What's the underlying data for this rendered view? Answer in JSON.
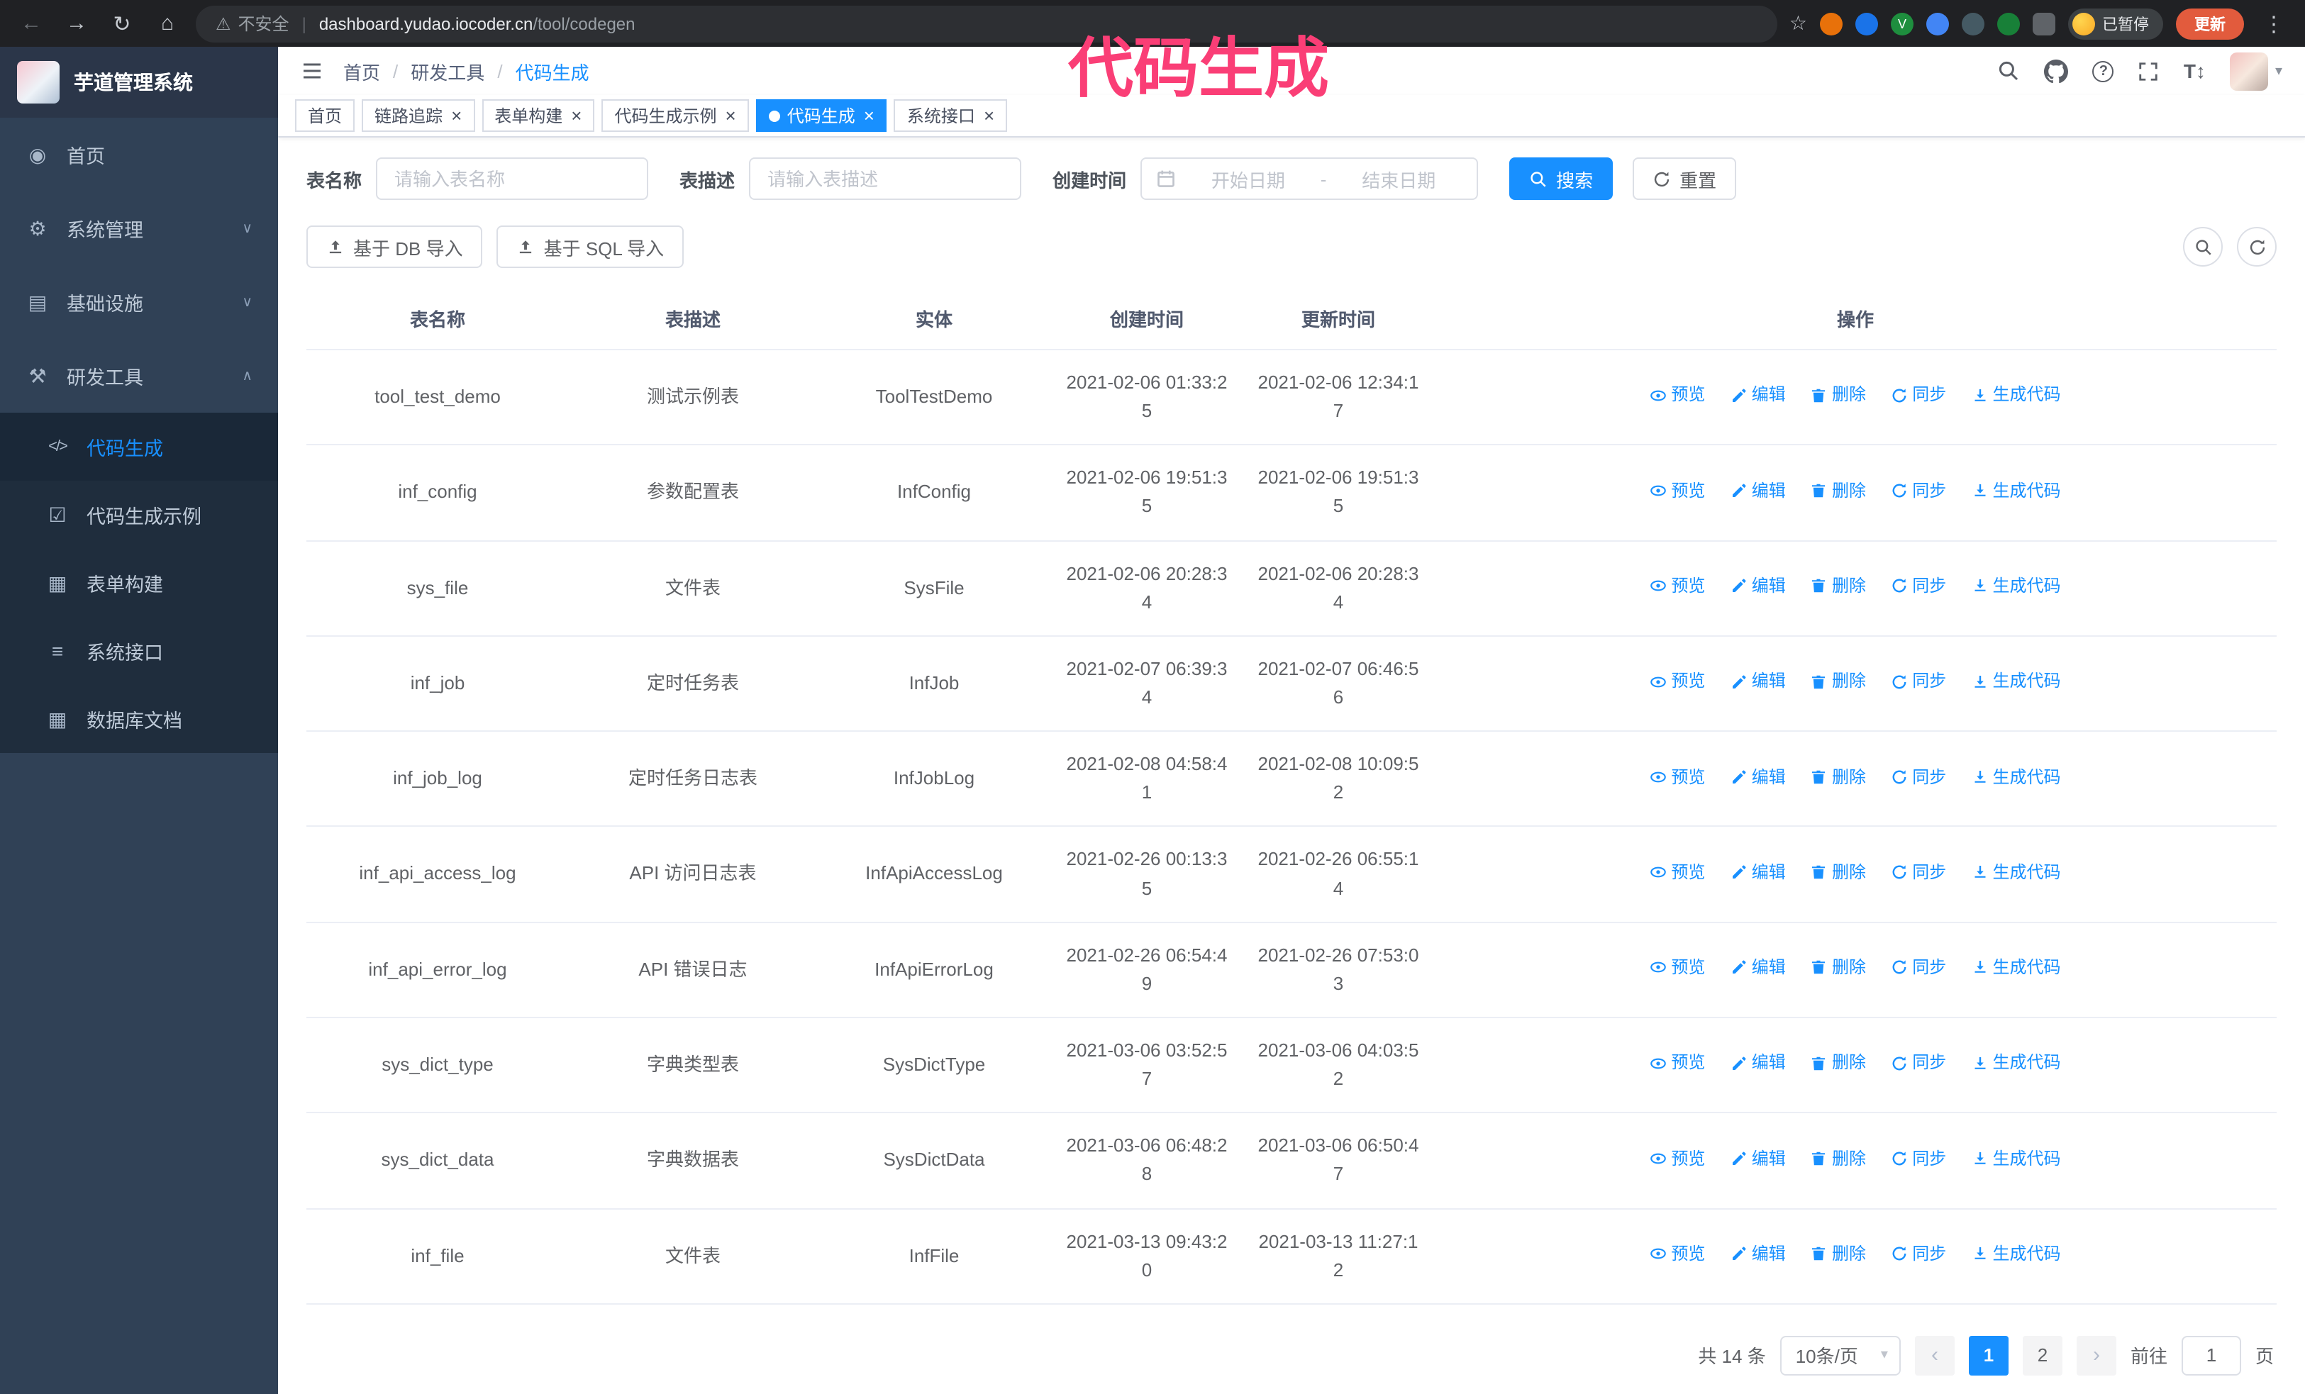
{
  "colors": {
    "accent": "#1890ff",
    "sidebar_bg": "#304156",
    "submenu_bg": "#1f2d3d",
    "annotation": "#fa3e76",
    "update_button": "#e25b3d"
  },
  "annotation": {
    "text": "代码生成"
  },
  "glyphs": {
    "back": "←",
    "forward": "→",
    "reload": "↻",
    "home": "⌂",
    "warning": "⚠",
    "star": "☆",
    "kebab": "⋮",
    "close": "×",
    "caret_down": "▾",
    "chevron_down": "∨",
    "chevron_up": "∧",
    "prev": "‹",
    "next": "›",
    "breadcrumb_sep": "/",
    "font_size": "T↕",
    "question": "?"
  },
  "browser": {
    "security_label": "不安全",
    "url_host": "dashboard.yudao.iocoder.cn",
    "url_path": "/tool/codegen",
    "paused_badge": "已暂停",
    "update_button": "更新"
  },
  "sidebar": {
    "logo_title": "芋道管理系统",
    "items": [
      {
        "label": "首页",
        "icon": "dashboard-icon",
        "glyph": "◉"
      },
      {
        "label": "系统管理",
        "icon": "gear-icon",
        "glyph": "⚙"
      },
      {
        "label": "基础设施",
        "icon": "monitor-icon",
        "glyph": "▤"
      },
      {
        "label": "研发工具",
        "icon": "tools-icon",
        "glyph": "⚒"
      }
    ],
    "subitems": [
      {
        "label": "代码生成",
        "icon": "code-icon",
        "glyph": "</>",
        "active": true
      },
      {
        "label": "代码生成示例",
        "icon": "example-icon",
        "glyph": "☑"
      },
      {
        "label": "表单构建",
        "icon": "form-builder-icon",
        "glyph": "▦"
      },
      {
        "label": "系统接口",
        "icon": "api-icon",
        "glyph": "≡"
      },
      {
        "label": "数据库文档",
        "icon": "db-doc-icon",
        "glyph": "▦"
      }
    ]
  },
  "header": {
    "breadcrumb": [
      "首页",
      "研发工具",
      "代码生成"
    ]
  },
  "tabs": [
    {
      "label": "首页",
      "closable": false,
      "active": false
    },
    {
      "label": "链路追踪",
      "closable": true,
      "active": false
    },
    {
      "label": "表单构建",
      "closable": true,
      "active": false
    },
    {
      "label": "代码生成示例",
      "closable": true,
      "active": false
    },
    {
      "label": "代码生成",
      "closable": true,
      "active": true
    },
    {
      "label": "系统接口",
      "closable": true,
      "active": false
    }
  ],
  "filters": {
    "table_name_label": "表名称",
    "table_name_placeholder": "请输入表名称",
    "table_desc_label": "表描述",
    "table_desc_placeholder": "请输入表描述",
    "create_time_label": "创建时间",
    "date_start_placeholder": "开始日期",
    "date_separator": "-",
    "date_end_placeholder": "结束日期",
    "search_label": "搜索",
    "reset_label": "重置"
  },
  "toolbar": {
    "import_db_label": "基于 DB 导入",
    "import_sql_label": "基于 SQL 导入"
  },
  "table": {
    "columns": [
      "表名称",
      "表描述",
      "实体",
      "创建时间",
      "更新时间",
      "操作"
    ],
    "actions": [
      "预览",
      "编辑",
      "删除",
      "同步",
      "生成代码"
    ],
    "rows": [
      {
        "name": "tool_test_demo",
        "desc": "测试示例表",
        "entity": "ToolTestDemo",
        "created": "2021-02-06 01:33:25",
        "updated": "2021-02-06 12:34:17"
      },
      {
        "name": "inf_config",
        "desc": "参数配置表",
        "entity": "InfConfig",
        "created": "2021-02-06 19:51:35",
        "updated": "2021-02-06 19:51:35"
      },
      {
        "name": "sys_file",
        "desc": "文件表",
        "entity": "SysFile",
        "created": "2021-02-06 20:28:34",
        "updated": "2021-02-06 20:28:34"
      },
      {
        "name": "inf_job",
        "desc": "定时任务表",
        "entity": "InfJob",
        "created": "2021-02-07 06:39:34",
        "updated": "2021-02-07 06:46:56"
      },
      {
        "name": "inf_job_log",
        "desc": "定时任务日志表",
        "entity": "InfJobLog",
        "created": "2021-02-08 04:58:41",
        "updated": "2021-02-08 10:09:52"
      },
      {
        "name": "inf_api_access_log",
        "desc": "API 访问日志表",
        "entity": "InfApiAccessLog",
        "created": "2021-02-26 00:13:35",
        "updated": "2021-02-26 06:55:14"
      },
      {
        "name": "inf_api_error_log",
        "desc": "API 错误日志",
        "entity": "InfApiErrorLog",
        "created": "2021-02-26 06:54:49",
        "updated": "2021-02-26 07:53:03"
      },
      {
        "name": "sys_dict_type",
        "desc": "字典类型表",
        "entity": "SysDictType",
        "created": "2021-03-06 03:52:57",
        "updated": "2021-03-06 04:03:52"
      },
      {
        "name": "sys_dict_data",
        "desc": "字典数据表",
        "entity": "SysDictData",
        "created": "2021-03-06 06:48:28",
        "updated": "2021-03-06 06:50:47"
      },
      {
        "name": "inf_file",
        "desc": "文件表",
        "entity": "InfFile",
        "created": "2021-03-13 09:43:20",
        "updated": "2021-03-13 11:27:12"
      }
    ]
  },
  "pagination": {
    "total": "共 14 条",
    "page_size": "10条/页",
    "pages": [
      "1",
      "2"
    ],
    "active_page": "1",
    "goto_label": "前往",
    "goto_value": "1",
    "goto_suffix": "页"
  }
}
